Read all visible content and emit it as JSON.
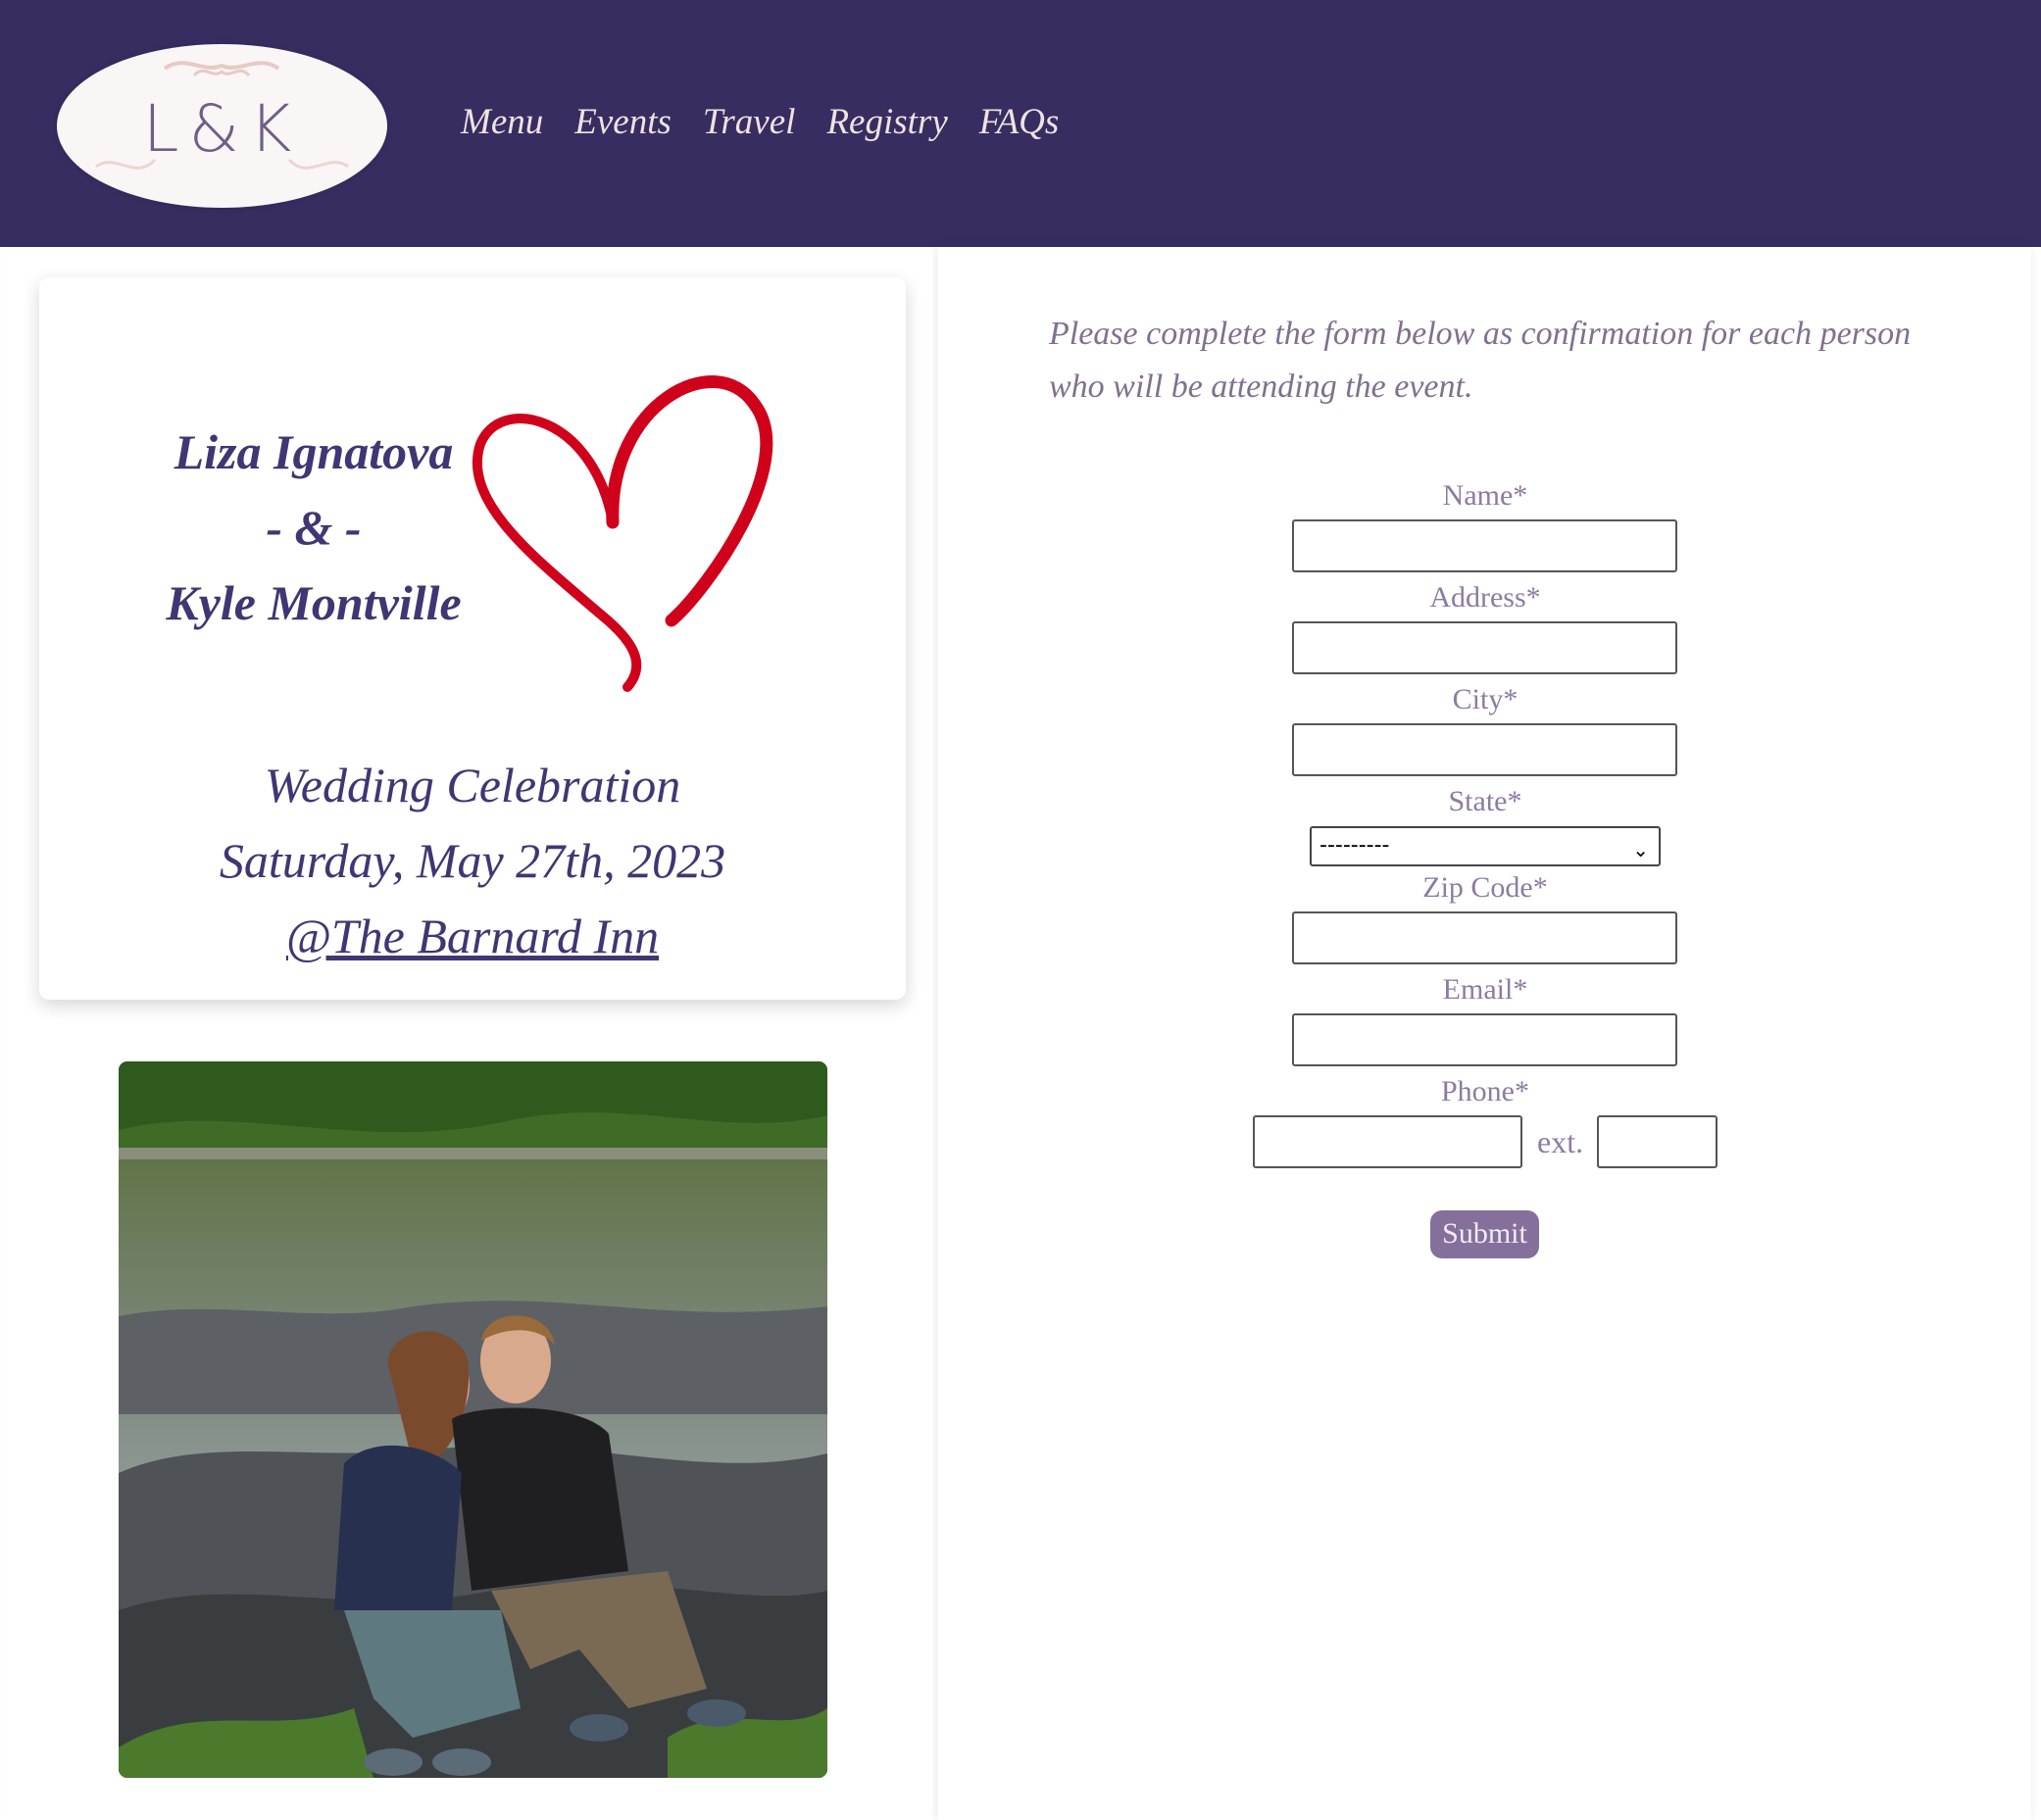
{
  "header": {
    "logo_text": "L&K",
    "nav": [
      "Menu",
      "Events",
      "Travel",
      "Registry",
      "FAQs"
    ]
  },
  "card": {
    "bride": "Liza Ignatova",
    "ampersand": "- & -",
    "groom": "Kyle Montville",
    "event_title": "Wedding Celebration",
    "event_date": "Saturday, May 27th, 2023",
    "venue_link": "@The Barnard Inn"
  },
  "form": {
    "intro": "Please complete the form below as confirmation for each person who will be attending the event.",
    "name_label": "Name*",
    "address_label": "Address*",
    "city_label": "City*",
    "state_label": "State*",
    "state_value": "---------",
    "zip_label": "Zip Code*",
    "email_label": "Email*",
    "phone_label": "Phone*",
    "ext_label": "ext.",
    "submit_label": "Submit"
  },
  "colors": {
    "header_bg": "#372d61",
    "heading_text": "#3f3773",
    "form_text": "#8e7ba0",
    "button_bg": "#84709b",
    "heart": "#d0021b"
  }
}
